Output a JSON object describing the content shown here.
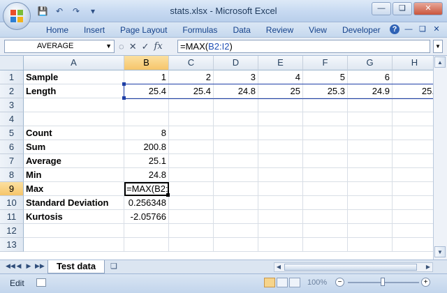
{
  "window": {
    "title": "stats.xlsx - Microsoft Excel",
    "minimize_icon": "minimize-icon",
    "restore_icon": "restore-icon",
    "close_icon": "close-icon"
  },
  "quick_access": {
    "save_icon": "save-icon",
    "undo_icon": "undo-icon",
    "redo_icon": "redo-icon",
    "customize_icon": "chevron-down-icon"
  },
  "ribbon": {
    "tabs": [
      "Home",
      "Insert",
      "Page Layout",
      "Formulas",
      "Data",
      "Review",
      "View",
      "Developer"
    ]
  },
  "formula_bar": {
    "name_box": "AVERAGE",
    "formula_prefix": "=MAX(",
    "formula_ref": "B2:I2",
    "formula_suffix": ")"
  },
  "columns": [
    "A",
    "B",
    "C",
    "D",
    "E",
    "F",
    "G",
    "H"
  ],
  "rows": [
    {
      "num": "1",
      "label": "Sample",
      "b": "1",
      "c": "2",
      "d": "3",
      "e": "4",
      "f": "5",
      "g": "6",
      "h": ""
    },
    {
      "num": "2",
      "label": "Length",
      "b": "25.4",
      "c": "25.4",
      "d": "24.8",
      "e": "25",
      "f": "25.3",
      "g": "24.9",
      "h": "25."
    },
    {
      "num": "3",
      "label": "",
      "b": ""
    },
    {
      "num": "4",
      "label": "",
      "b": ""
    },
    {
      "num": "5",
      "label": "Count",
      "b": "8"
    },
    {
      "num": "6",
      "label": "Sum",
      "b": "200.8"
    },
    {
      "num": "7",
      "label": "Average",
      "b": "25.1"
    },
    {
      "num": "8",
      "label": "Min",
      "b": "24.8"
    },
    {
      "num": "9",
      "label": "Max",
      "b": "=MAX(B2:"
    },
    {
      "num": "10",
      "label": "Standard Deviation",
      "b": "0.256348"
    },
    {
      "num": "11",
      "label": "Kurtosis",
      "b": "-2.05766"
    },
    {
      "num": "12",
      "label": "",
      "b": ""
    },
    {
      "num": "13",
      "label": "",
      "b": ""
    }
  ],
  "sheet_tabs": {
    "active": "Test data"
  },
  "status_bar": {
    "mode": "Edit",
    "zoom": "100%"
  },
  "colors": {
    "selection_border": "#1f3fa6",
    "header_highlight": "#f6c56a"
  }
}
